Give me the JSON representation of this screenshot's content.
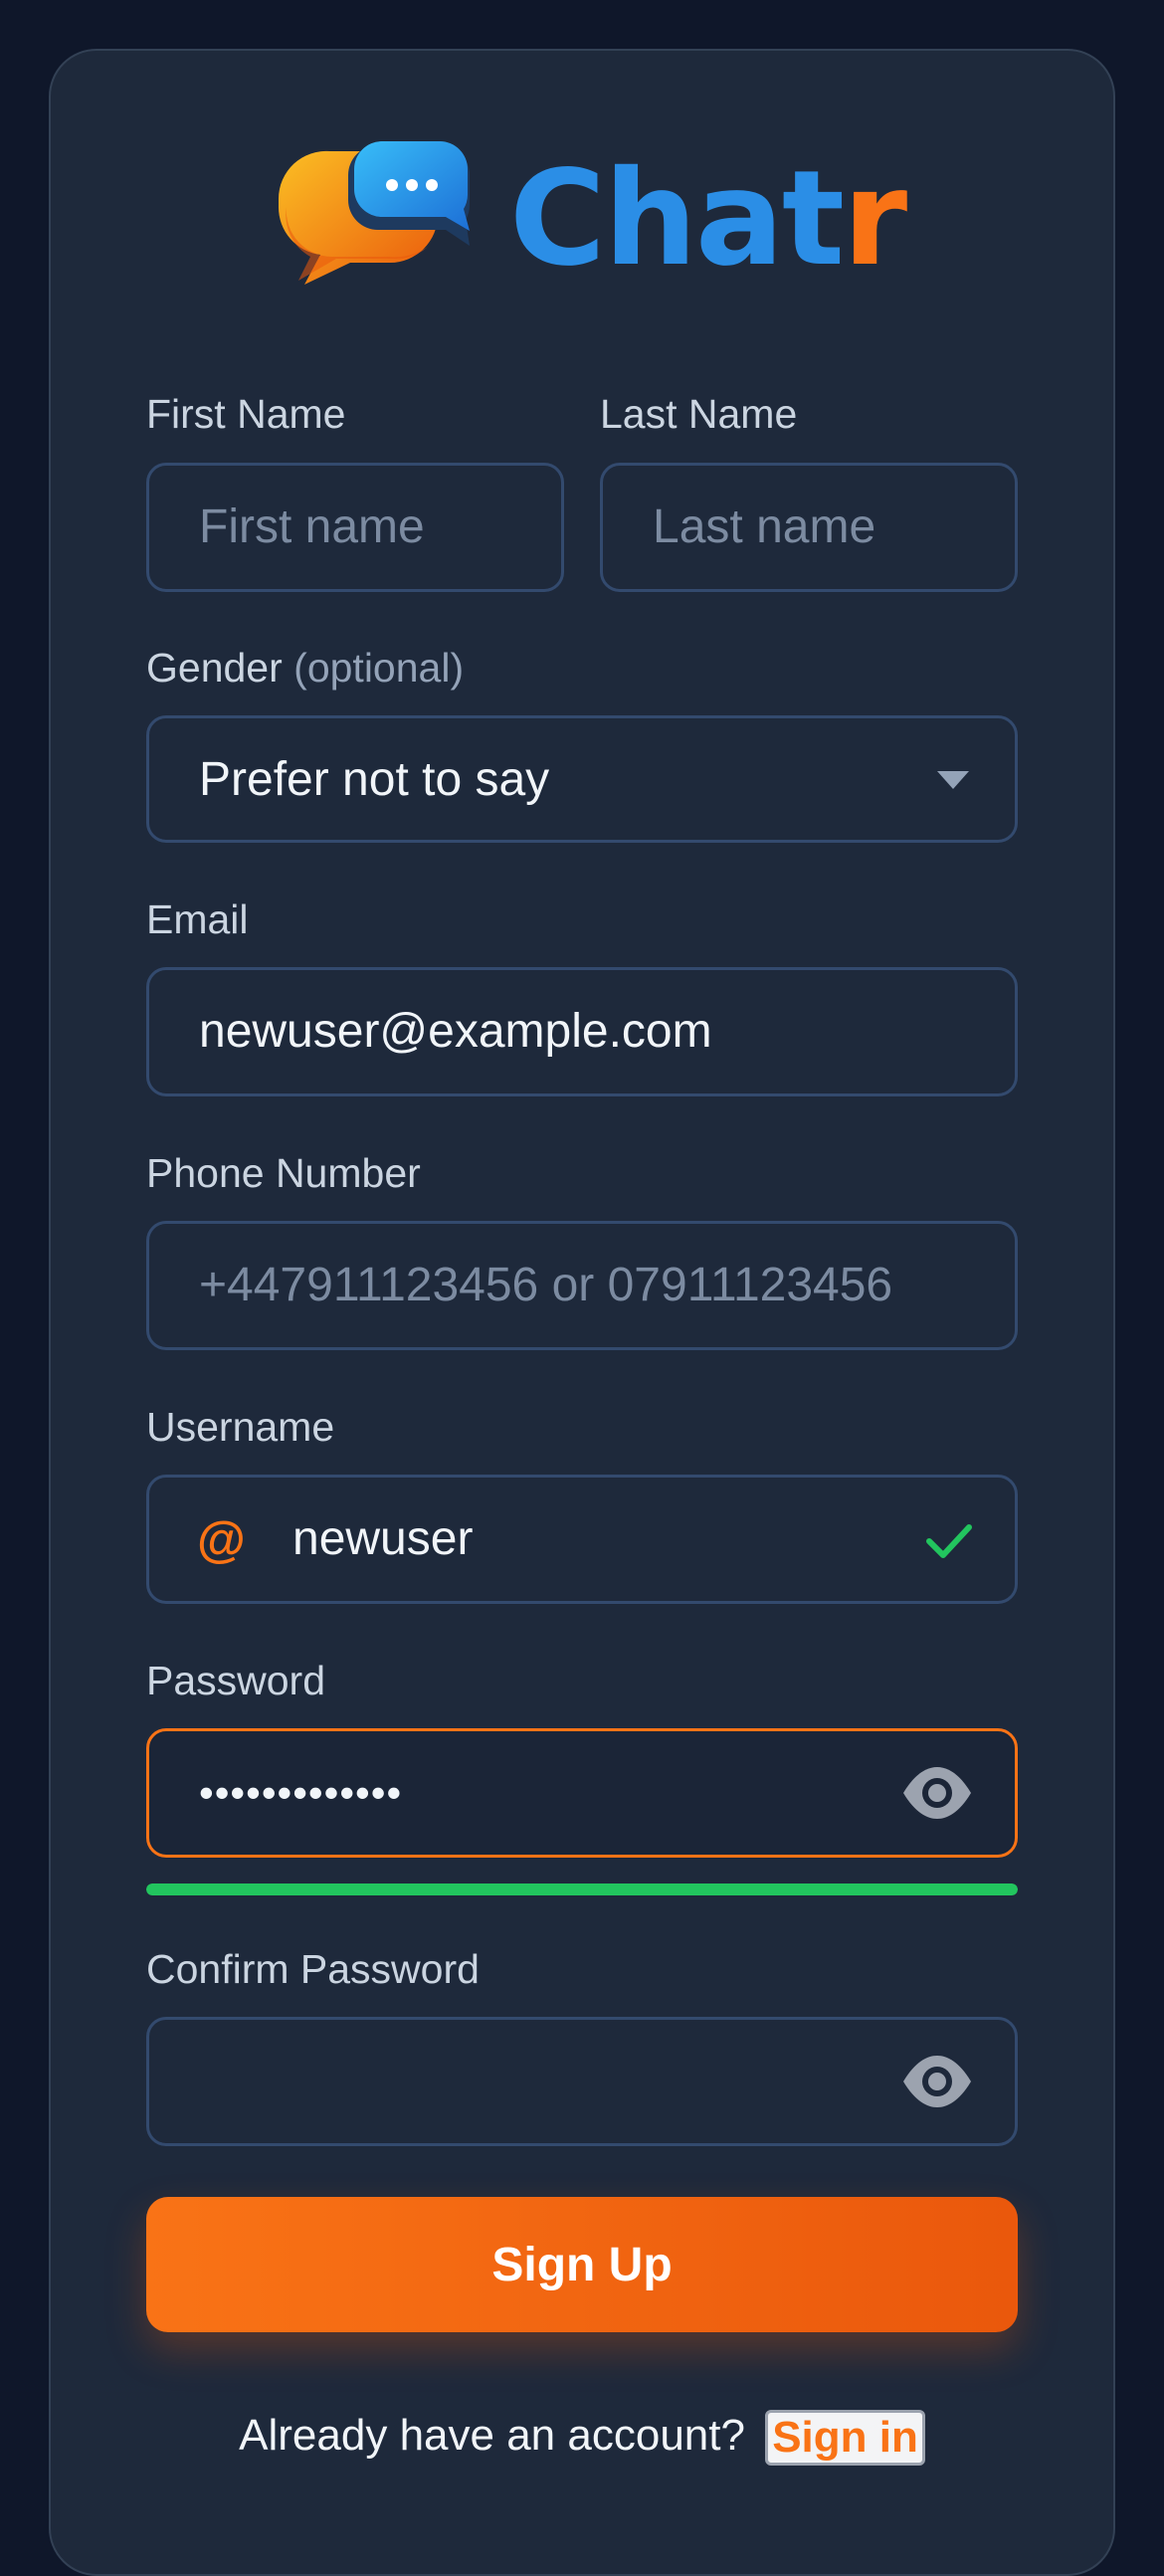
{
  "brand": {
    "name_main": "Chat",
    "name_accent": "r",
    "logo_icon": "chat-bubbles-icon",
    "colors": {
      "primary": "#2b8ee6",
      "accent": "#f97316",
      "success": "#22c55e"
    }
  },
  "form": {
    "first_name": {
      "label": "First Name",
      "placeholder": "First name",
      "value": ""
    },
    "last_name": {
      "label": "Last Name",
      "placeholder": "Last name",
      "value": ""
    },
    "gender": {
      "label": "Gender",
      "hint": "(optional)",
      "selected": "Prefer not to say",
      "icon": "chevron-down-icon"
    },
    "email": {
      "label": "Email",
      "value": "newuser@example.com"
    },
    "phone": {
      "label": "Phone Number",
      "placeholder": "+447911123456 or 07911123456",
      "value": ""
    },
    "username": {
      "label": "Username",
      "prefix": "@",
      "value": "newuser",
      "status_icon": "check-icon"
    },
    "password": {
      "label": "Password",
      "value": "•••••••••••••",
      "toggle_icon": "eye-icon",
      "strength": 1.0
    },
    "confirm_password": {
      "label": "Confirm Password",
      "value": "",
      "toggle_icon": "eye-icon"
    },
    "submit_label": "Sign Up"
  },
  "footer": {
    "prompt": "Already have an account?",
    "link_label": "Sign in"
  }
}
